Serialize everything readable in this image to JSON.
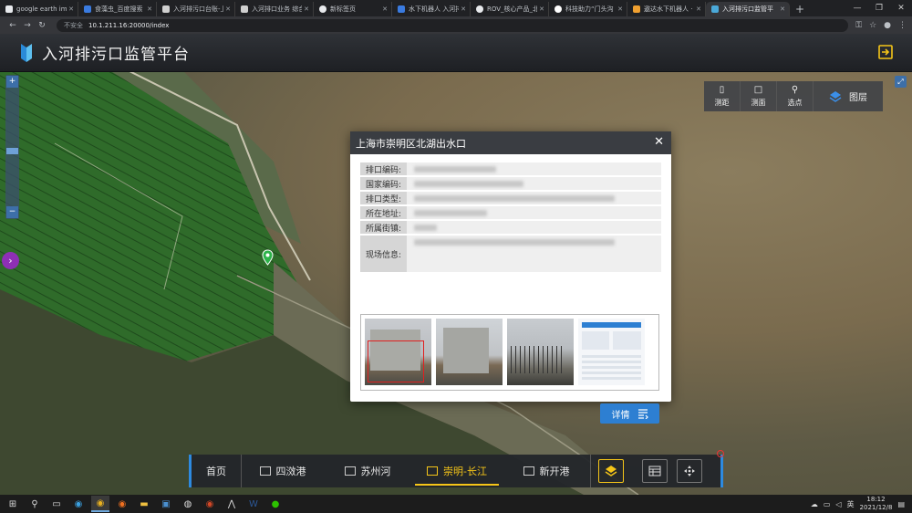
{
  "browser": {
    "tabs": [
      {
        "title": "google earth ima",
        "color": "#e8eaed"
      },
      {
        "title": "食藻虫_百度搜索",
        "color": "#3a7be0"
      },
      {
        "title": "入河排污口台账-上",
        "color": "#d0d0d0"
      },
      {
        "title": "入河排口业务 综合",
        "color": "#d0d0d0"
      },
      {
        "title": "新标签页",
        "color": "#e8eaed"
      },
      {
        "title": "水下机器人 入河排",
        "color": "#3a7be0"
      },
      {
        "title": "ROV_核心产品_北",
        "color": "#e8eaed"
      },
      {
        "title": "科技助力“门头沟",
        "color": "#ffffff"
      },
      {
        "title": "遨达水下机器人 ·",
        "color": "#f0a030"
      },
      {
        "title": "入河排污口监管平",
        "color": "#4aa8d8"
      }
    ],
    "address": {
      "security": "不安全",
      "url": "10.1.211.16:20000/index"
    }
  },
  "app": {
    "title": "入河排污口监管平台"
  },
  "map_tools": {
    "measure_distance": "测距",
    "measure_area": "测面",
    "pick_point": "选点",
    "layers": "图层"
  },
  "popup": {
    "title": "上海市崇明区北湖出水口",
    "fields": [
      {
        "label": "排口编码:"
      },
      {
        "label": "国家编码:"
      },
      {
        "label": "排口类型:"
      },
      {
        "label": "所在地址:"
      },
      {
        "label": "所属街镇:"
      },
      {
        "label": "现场信息:"
      }
    ],
    "detail_button": "详情"
  },
  "bottom_nav": {
    "home": "首页",
    "items": [
      "四滧港",
      "苏州河",
      "崇明-长江",
      "新开港"
    ],
    "active_index": 2
  },
  "taskbar": {
    "time": "18:12",
    "date": "2021/12/8",
    "ime": "英"
  },
  "colors": {
    "accent_blue": "#2d7fd2",
    "active_yellow": "#f5c518",
    "header_bg": "#2f3237"
  }
}
